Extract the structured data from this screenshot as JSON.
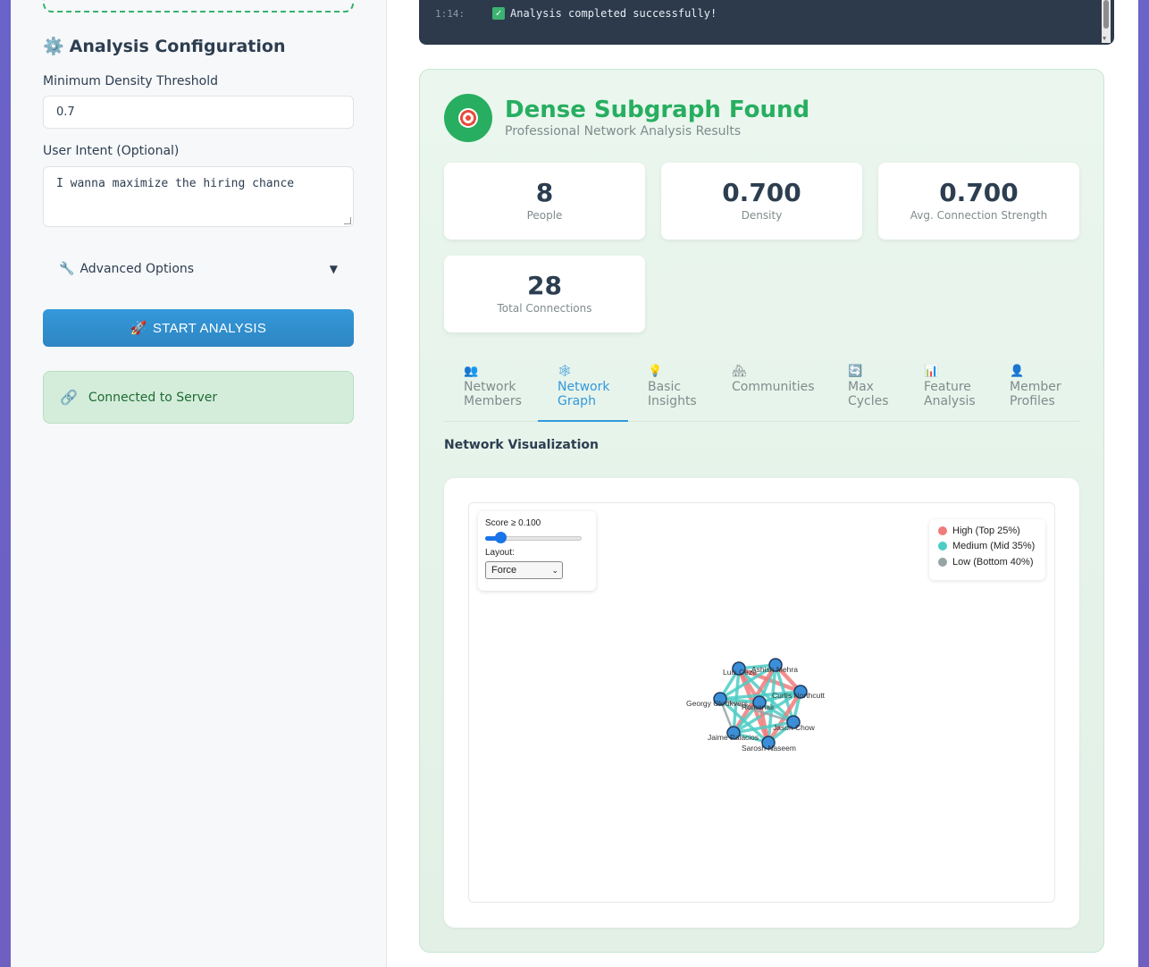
{
  "sidebar": {
    "title": "Analysis Configuration",
    "density_label": "Minimum Density Threshold",
    "density_value": "0.7",
    "intent_label": "User Intent (Optional)",
    "intent_value": "I wanna maximize the hiring chance",
    "advanced_label": "Advanced Options",
    "advanced_arrow": "▼",
    "start_button": "START ANALYSIS",
    "status_text": "Connected to Server"
  },
  "console": {
    "time": "1:14:",
    "message": "Analysis completed successfully!"
  },
  "results": {
    "title": "Dense Subgraph Found",
    "subtitle": "Professional Network Analysis Results",
    "stats": [
      {
        "value": "8",
        "label": "People"
      },
      {
        "value": "0.700",
        "label": "Density"
      },
      {
        "value": "0.700",
        "label": "Avg. Connection Strength"
      },
      {
        "value": "28",
        "label": "Total Connections"
      }
    ],
    "tabs": [
      {
        "icon": "👥",
        "line1": "Network",
        "line2": "Members"
      },
      {
        "icon": "🕸",
        "line1": "Network",
        "line2": "Graph"
      },
      {
        "icon": "💡",
        "line1": "Basic",
        "line2": "Insights"
      },
      {
        "icon": "🏘",
        "line1": "Communities",
        "line2": ""
      },
      {
        "icon": "🔄",
        "line1": "Max",
        "line2": "Cycles"
      },
      {
        "icon": "📊",
        "line1": "Feature",
        "line2": "Analysis"
      },
      {
        "icon": "👤",
        "line1": "Member",
        "line2": "Profiles"
      }
    ],
    "section_label": "Network Visualization"
  },
  "graph": {
    "score_label": "Score ≥ 0.100",
    "score_value": 0.1,
    "layout_label": "Layout:",
    "layout_value": "Force",
    "legend": [
      {
        "label": "High (Top 25%)",
        "color": "#f07b7b"
      },
      {
        "label": "Medium (Mid 35%)",
        "color": "#4ecdc4"
      },
      {
        "label": "Low (Bottom 40%)",
        "color": "#95a5a6"
      }
    ],
    "nodes": [
      "Luis Ceze",
      "Ashish Mehra",
      "Curtis Northcutt",
      "Romenair",
      "Georgy Okrokvers",
      "Jason Chow",
      "Jaime Palacios",
      "Sarosh Naseem"
    ]
  },
  "colors": {
    "accent": "#3498db",
    "success": "#27ae60",
    "node": "#3b8fd9"
  }
}
